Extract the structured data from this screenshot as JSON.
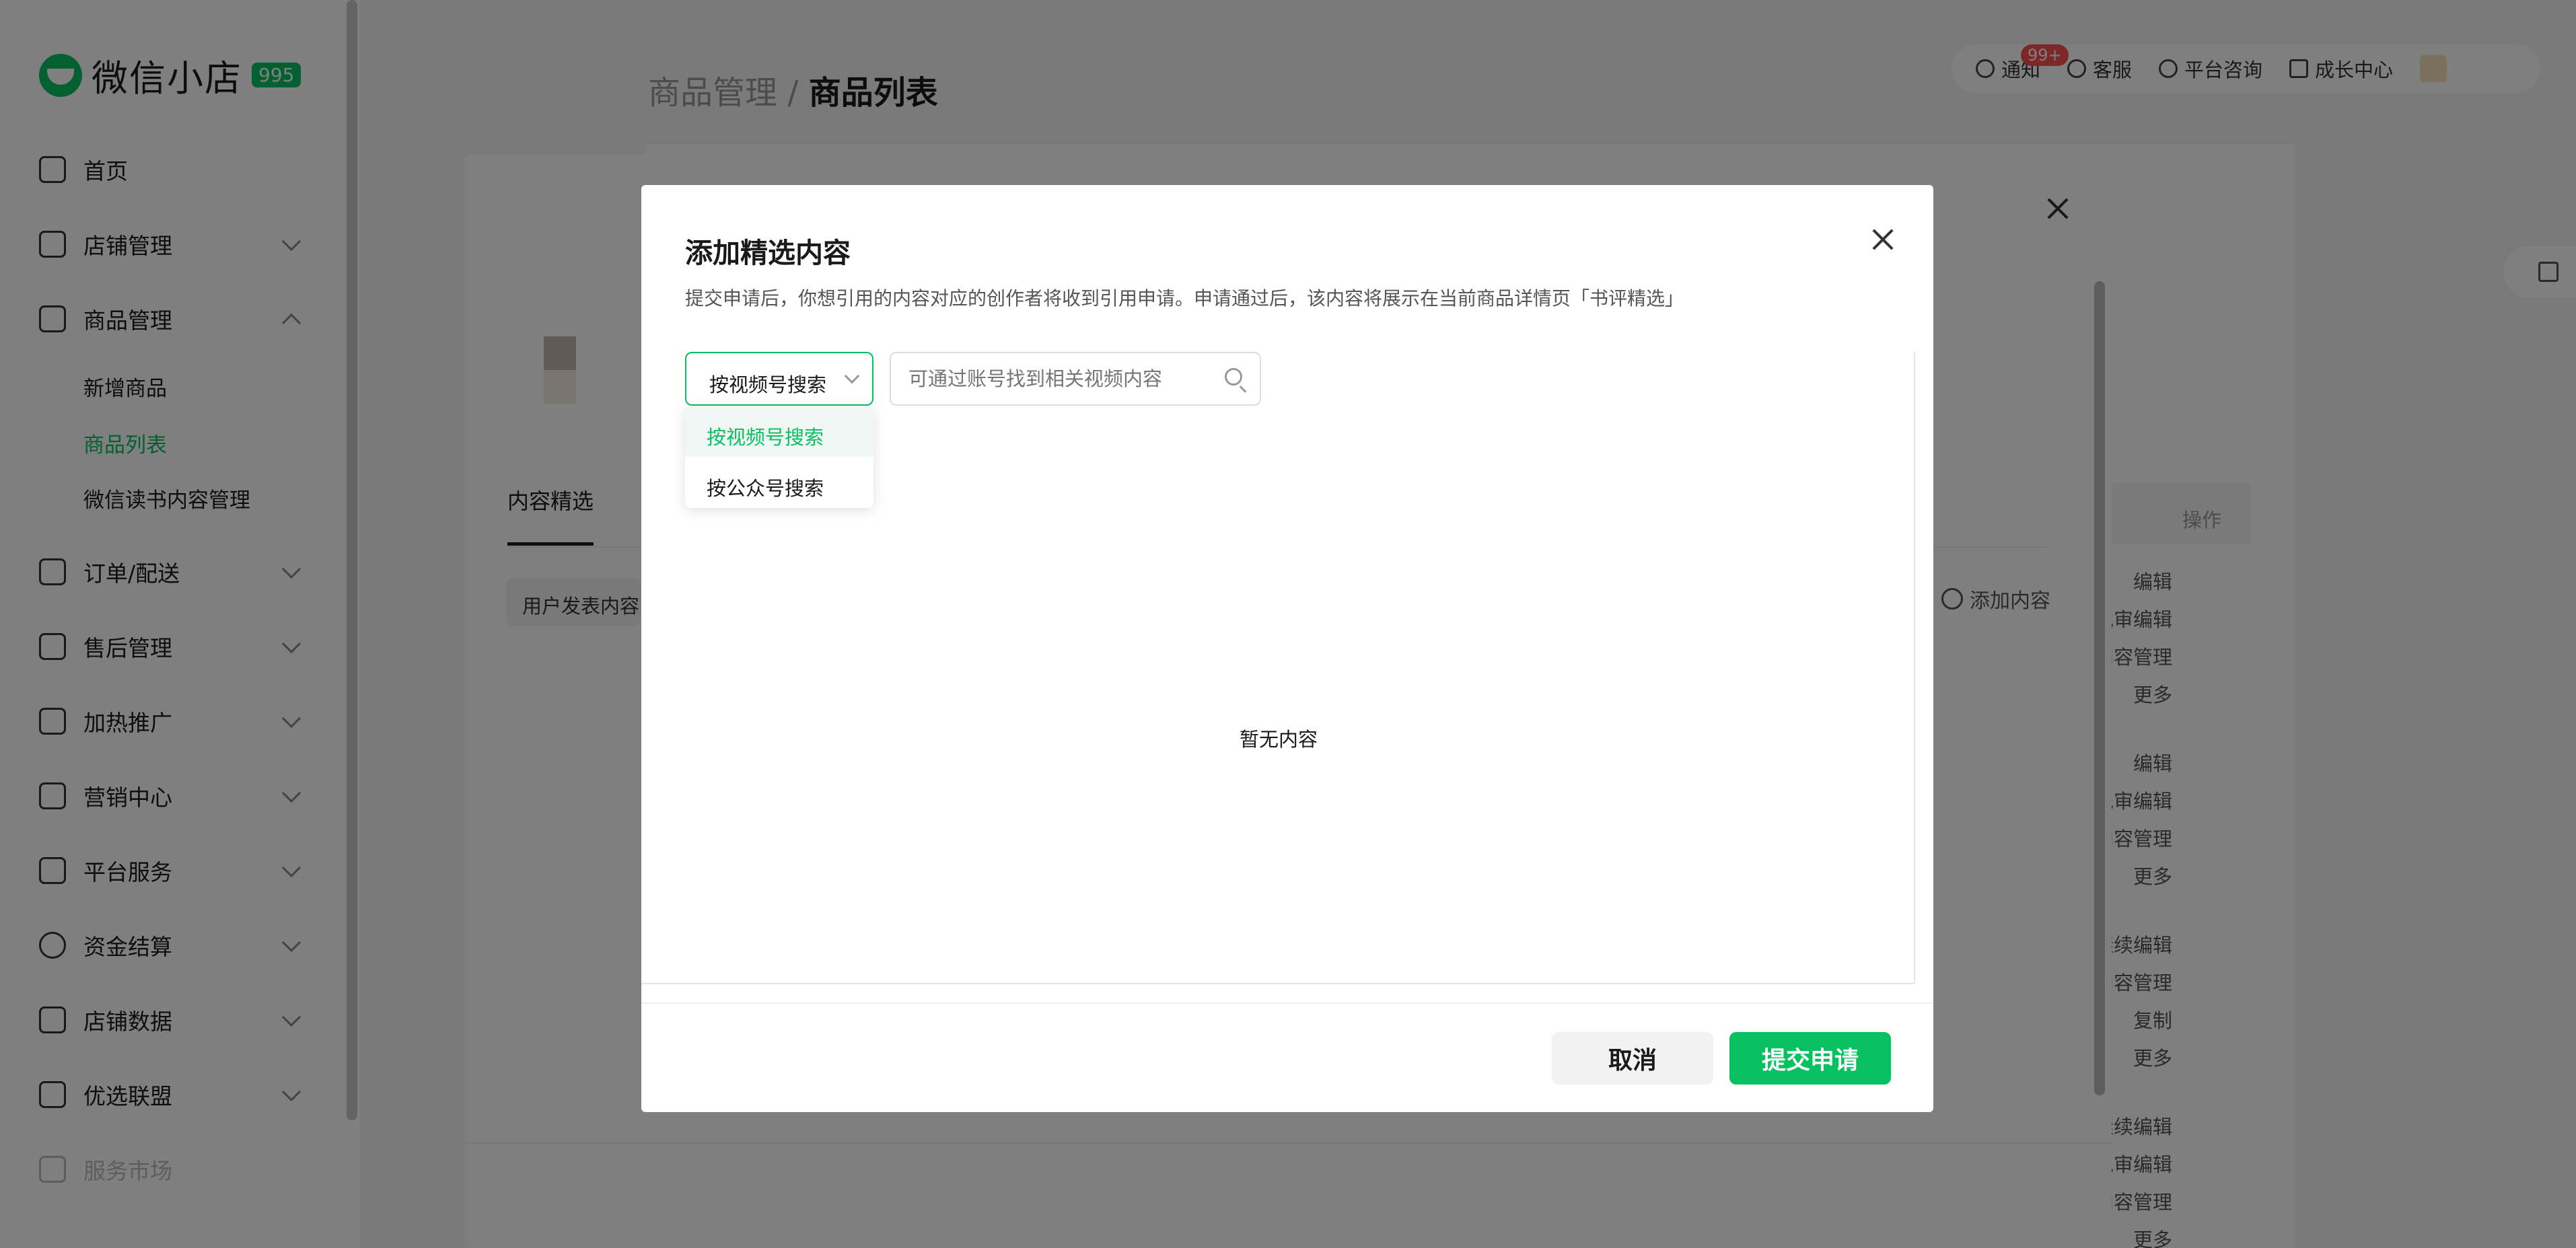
{
  "sidebar": {
    "logo_text": "微信小店",
    "logo_badge": "995",
    "items": [
      {
        "label": "首页"
      },
      {
        "label": "店铺管理"
      },
      {
        "label": "商品管理"
      },
      {
        "label": "订单/配送"
      },
      {
        "label": "售后管理"
      },
      {
        "label": "加热推广"
      },
      {
        "label": "营销中心"
      },
      {
        "label": "平台服务"
      },
      {
        "label": "资金结算"
      },
      {
        "label": "店铺数据"
      },
      {
        "label": "优选联盟"
      },
      {
        "label": "服务市场"
      }
    ],
    "sub_items": [
      {
        "label": "新增商品"
      },
      {
        "label": "商品列表"
      },
      {
        "label": "微信读书内容管理"
      }
    ]
  },
  "header": {
    "breadcrumb_parent": "商品管理",
    "breadcrumb_sep": "/",
    "breadcrumb_current": "商品列表",
    "notify": "通知",
    "notify_badge": "99+",
    "service": "客服",
    "consult": "平台咨询",
    "growth": "成长中心"
  },
  "background_modal": {
    "tab_active": "内容精选",
    "chip": "用户发表内容",
    "add_content": "添加内容"
  },
  "table_ops": {
    "header": "操作",
    "rows": [
      [
        "编辑",
        "免审编辑",
        "内容管理",
        "更多"
      ],
      [
        "编辑",
        "免审编辑",
        "内容管理",
        "更多"
      ],
      [
        "继续编辑",
        "内容管理",
        "复制",
        "更多"
      ],
      [
        "继续编辑",
        "免审编辑",
        "内容管理",
        "更多"
      ]
    ]
  },
  "dialog": {
    "title": "添加精选内容",
    "description": "提交申请后，你想引用的内容对应的创作者将收到引用申请。申请通过后，该内容将展示在当前商品详情页「书评精选」",
    "select_value": "按视频号搜索",
    "search_placeholder": "可通过账号找到相关视频内容",
    "options": [
      {
        "label": "按视频号搜索",
        "selected": true
      },
      {
        "label": "按公众号搜索",
        "selected": false
      }
    ],
    "empty_text": "暂无内容",
    "cancel_label": "取消",
    "submit_label": "提交申请"
  },
  "colors": {
    "accent": "#07c160",
    "overlay": "rgba(0,0,0,0.5)",
    "badge": "#fa5151"
  }
}
